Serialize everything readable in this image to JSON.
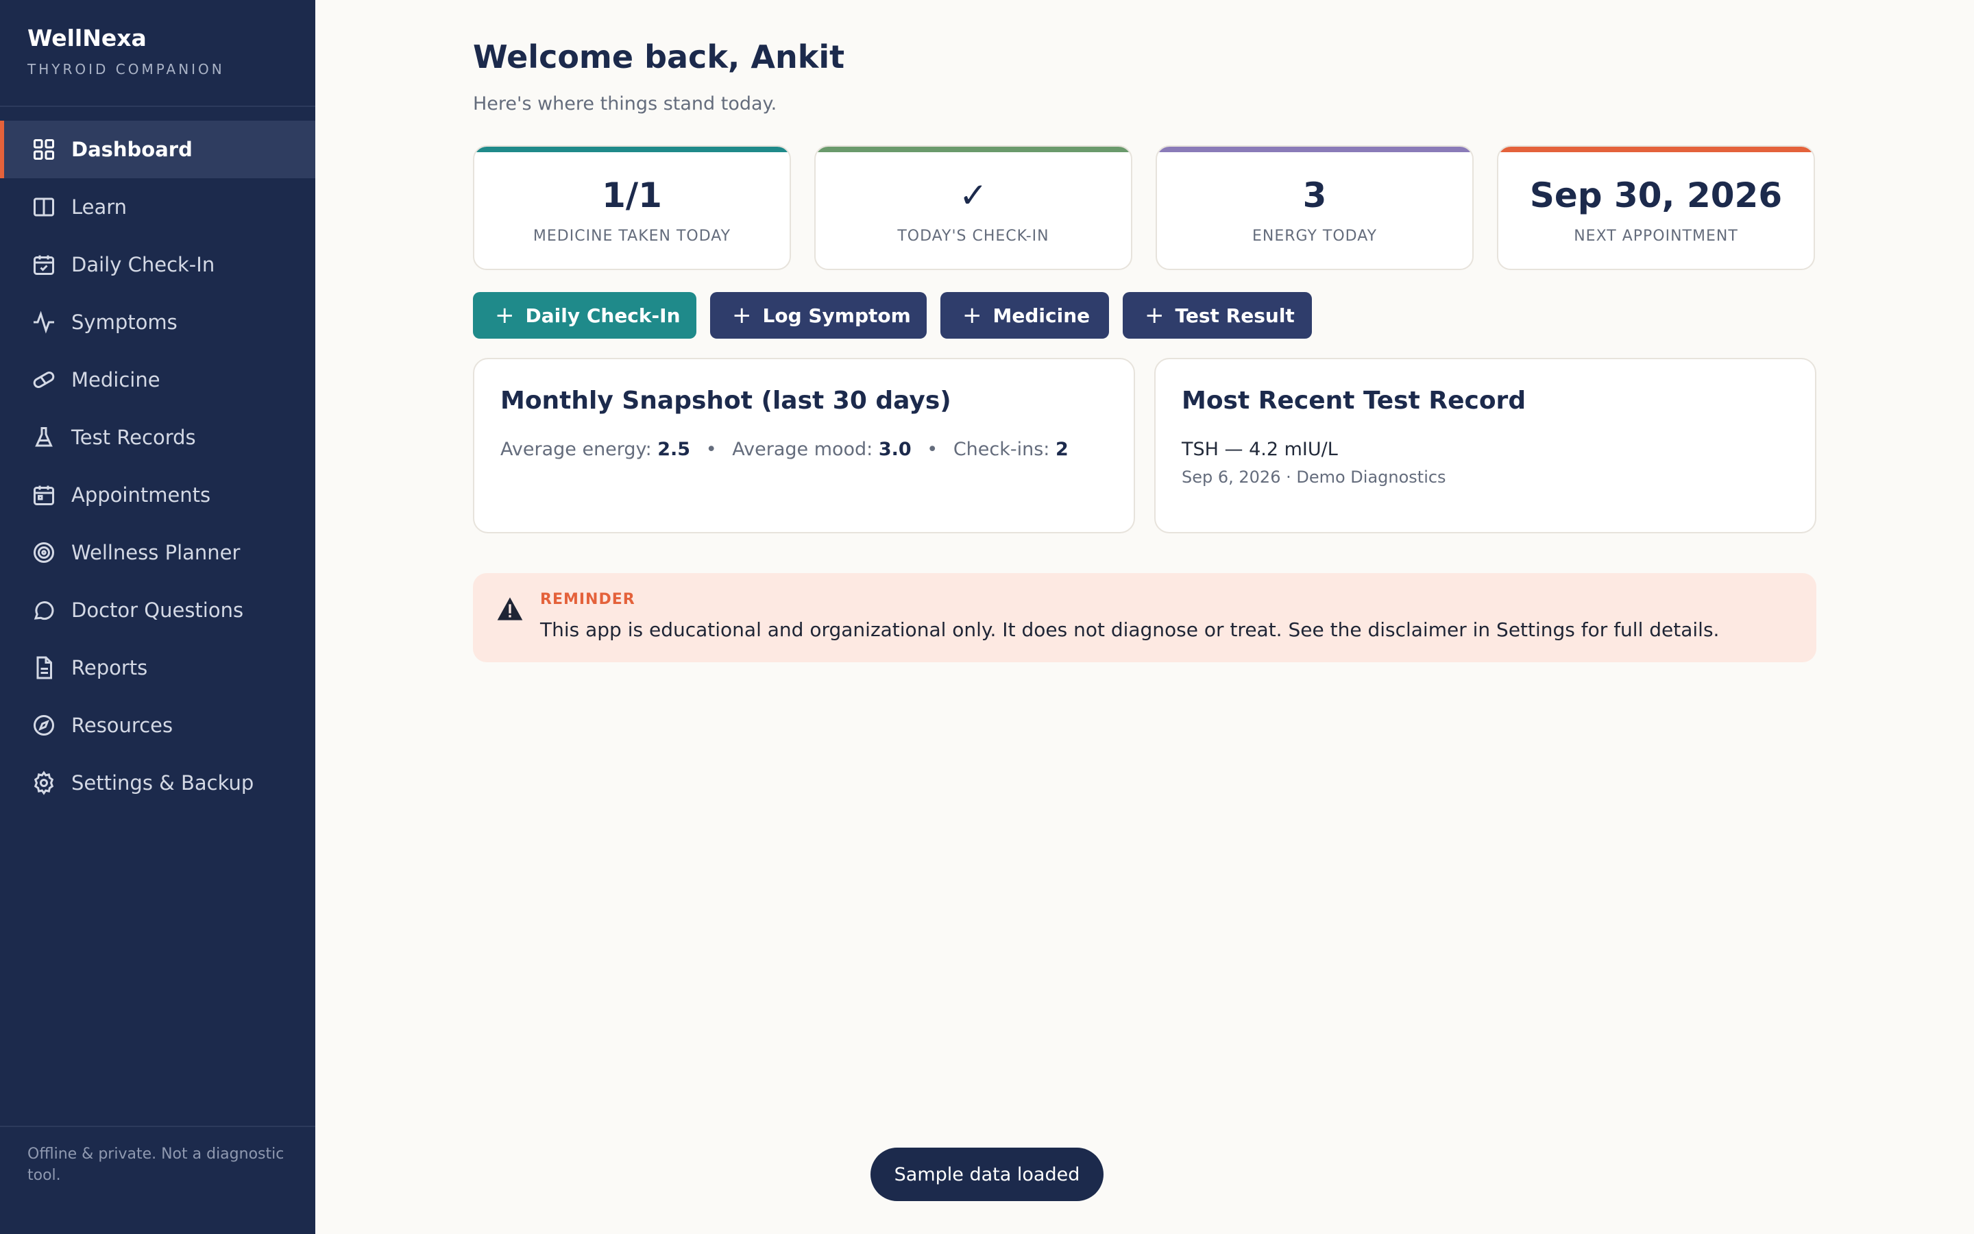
{
  "brand": {
    "name": "WellNexa",
    "subtitle": "THYROID COMPANION"
  },
  "nav": {
    "items": [
      {
        "label": "Dashboard",
        "icon": "grid-icon",
        "active": true
      },
      {
        "label": "Learn",
        "icon": "book-icon"
      },
      {
        "label": "Daily Check-In",
        "icon": "calendar-check-icon"
      },
      {
        "label": "Symptoms",
        "icon": "activity-icon"
      },
      {
        "label": "Medicine",
        "icon": "pill-icon"
      },
      {
        "label": "Test Records",
        "icon": "flask-icon"
      },
      {
        "label": "Appointments",
        "icon": "calendar-icon"
      },
      {
        "label": "Wellness Planner",
        "icon": "target-icon"
      },
      {
        "label": "Doctor Questions",
        "icon": "chat-icon"
      },
      {
        "label": "Reports",
        "icon": "document-icon"
      },
      {
        "label": "Resources",
        "icon": "compass-icon"
      },
      {
        "label": "Settings & Backup",
        "icon": "gear-icon"
      }
    ],
    "footer": "Offline & private. Not a diagnostic tool."
  },
  "header": {
    "title": "Welcome back, Ankit",
    "subtitle": "Here's where things stand today."
  },
  "stats": [
    {
      "value": "1/1",
      "label": "MEDICINE TAKEN TODAY",
      "color": "#1f8a8a"
    },
    {
      "value": "✓",
      "label": "TODAY'S CHECK-IN",
      "color": "#6a9a6c"
    },
    {
      "value": "3",
      "label": "ENERGY TODAY",
      "color": "#8a7bb8"
    },
    {
      "value": "Sep 30, 2026",
      "label": "NEXT APPOINTMENT",
      "color": "#e4623b"
    }
  ],
  "actions": [
    {
      "label": "Daily Check-In",
      "color": "#1f8a8a"
    },
    {
      "label": "Log Symptom",
      "color": "#2f3d6b"
    },
    {
      "label": "Medicine",
      "color": "#2f3d6b"
    },
    {
      "label": "Test Result",
      "color": "#2f3d6b"
    }
  ],
  "snapshot": {
    "title": "Monthly Snapshot (last 30 days)",
    "energy_label": "Average energy:",
    "energy_value": "2.5",
    "mood_label": "Average mood:",
    "mood_value": "3.0",
    "checkins_label": "Check-ins:",
    "checkins_value": "2",
    "separator": "•"
  },
  "recent_test": {
    "title": "Most Recent Test Record",
    "result": "TSH — 4.2 mIU/L",
    "detail": "Sep 6, 2026 · Demo Diagnostics"
  },
  "reminder": {
    "label": "REMINDER",
    "text": "This app is educational and organizational only. It does not diagnose or treat. See the disclaimer in Settings for full details."
  },
  "toast": "Sample data loaded"
}
